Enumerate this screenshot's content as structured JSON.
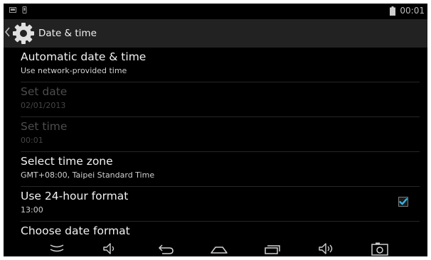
{
  "status_bar": {
    "time": "00:01",
    "icons": [
      "screenshot-notification-icon",
      "usb-notification-icon",
      "battery-icon"
    ]
  },
  "action_bar": {
    "title": "Date & time",
    "icons": [
      "back-caret-icon",
      "settings-gear-icon"
    ]
  },
  "settings": [
    {
      "title": "Automatic date & time",
      "summary": "Use network-provided time",
      "enabled": true
    },
    {
      "title": "Set date",
      "summary": "02/01/2013",
      "enabled": false
    },
    {
      "title": "Set time",
      "summary": "00:01",
      "enabled": false
    },
    {
      "title": "Select time zone",
      "summary": "GMT+08:00, Taipei Standard Time",
      "enabled": true
    },
    {
      "title": "Use 24-hour format",
      "summary": "13:00",
      "enabled": true,
      "checked": true
    },
    {
      "title": "Choose date format",
      "enabled": true
    }
  ],
  "nav_bar": {
    "icons": [
      "hide-keyboard-icon",
      "volume-down-icon",
      "back-icon",
      "home-icon",
      "recent-apps-icon",
      "volume-up-icon",
      "camera-icon"
    ]
  },
  "colors": {
    "background": "#000000",
    "action_bar": "#222222",
    "accent": "#33b5e5",
    "text_primary": "#f2f2f2",
    "text_disabled": "#4d4d4d"
  }
}
